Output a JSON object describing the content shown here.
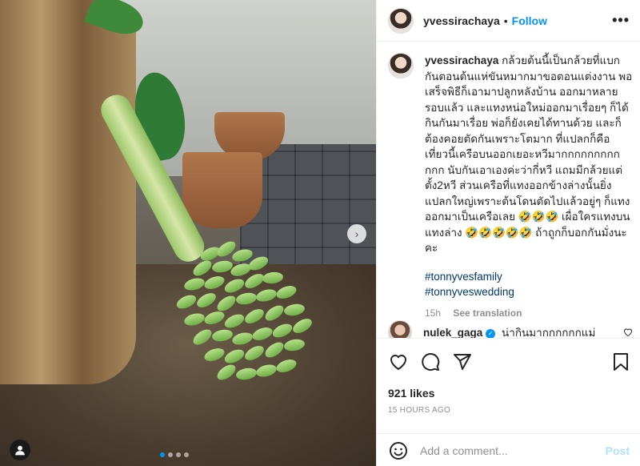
{
  "post": {
    "username": "yvessirachaya",
    "separator": "•",
    "follow_label": "Follow",
    "more_label": "•••",
    "caption_text": "กล้วยต้นนี้เป็นกล้วยที่แบกกันตอนต้นแห่ขันหมากมาขอตอนแต่งงาน พอเสร็จพิธีก็เอามาปลูกหลังบ้าน ออกมาหลายรอบแล้ว และแทงหน่อใหม่ออกมาเรื่อยๆ ก็ได้กินกันมาเรื่อย พ่อก็ยังเคยได้ทานด้วย และก็ต้องคอยตัดกันเพราะโตมาก ที่แปลกก็คือเที่ยวนี้เครือบนออกเยอะหวีมากกกกกกกกกกกก นับกันเอาเองค่ะว่ากี่หวี แถมมีกล้วยแต่ตั้ง2หวี ส่วนเครือที่แทงออกข้างล่างนั้นยิ่งแปลกใหญ่เพราะต้นโดนตัดไปแล้วอยู่ๆ ก็แทงออกมาเป็นเครือเลย 🤣🤣🤣 เผื่อใครแทงบนแทงล่าง 🤣🤣🤣🤣🤣 ถ้าถูกก็บอกกันมั่งนะคะ",
    "hashtags": [
      "#tonnyvesfamily",
      "#tonnyveswedding"
    ],
    "caption_time": "15h",
    "see_translation": "See translation",
    "comment": {
      "username": "nulek_gaga",
      "verified_glyph": "✓",
      "text": "น่ากินมากกกกกกแม่"
    },
    "likes": "921 likes",
    "timestamp": "15 HOURS AGO",
    "add_comment_placeholder": "Add a comment...",
    "post_label": "Post"
  },
  "image": {
    "next_arrow": "›",
    "user_tag_glyph": "👤"
  },
  "icons": [
    "heart-icon",
    "comment-icon",
    "share-icon",
    "bookmark-icon",
    "emoji-icon",
    "chevron-right-icon",
    "user-tag-icon",
    "more-icon",
    "verified-icon"
  ],
  "colors": {
    "accent": "#0095f6",
    "link": "#00376b",
    "muted": "#8e8e8e",
    "post_disabled": "#b2dffc"
  }
}
